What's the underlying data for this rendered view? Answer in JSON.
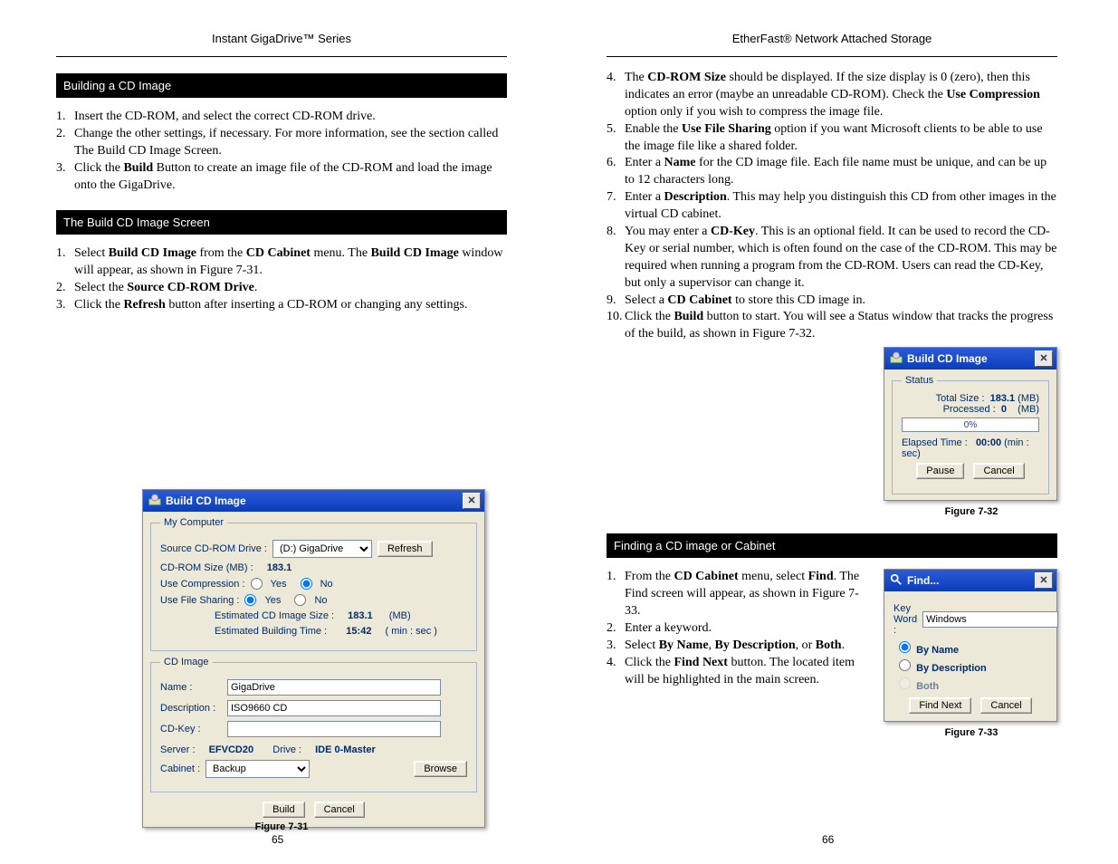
{
  "left": {
    "series_title": "Instant GigaDrive™ Series",
    "section_build_title": "Building a CD Image",
    "build_steps": [
      "Insert the CD-ROM, and select the correct CD-ROM drive.",
      "Change the other settings, if necessary. For more information, see the section called The Build CD Image Screen.",
      "Click the Build Button to create an image file of the CD-ROM and load the image onto the GigaDrive."
    ],
    "section_screen_title": "The Build CD Image Screen",
    "screen_steps": [
      "Select Build CD Image from the CD Cabinet menu. The Build CD Image window will appear, as shown in Figure 7-31.",
      "Select the Source CD-ROM Drive.",
      "Click the Refresh button after inserting a CD-ROM or changing any settings."
    ],
    "dlg": {
      "title": "Build CD Image",
      "grp_mycomputer": "My Computer",
      "src_label": "Source CD-ROM Drive :",
      "drive_options": [
        "(D:) GigaDrive"
      ],
      "refresh": "Refresh",
      "size_label": "CD-ROM Size (MB) :",
      "size_value": "183.1",
      "compress_label": "Use Compression :",
      "fileshare_label": "Use File Sharing :",
      "yes": "Yes",
      "no": "No",
      "est_size_label": "Estimated CD Image Size :",
      "est_size_value": "183.1",
      "est_size_unit": "(MB)",
      "est_time_label": "Estimated Building Time :",
      "est_time_value": "15:42",
      "est_time_unit": "( min : sec )",
      "grp_cdimage": "CD Image",
      "name_label": "Name :",
      "name_value": "GigaDrive",
      "desc_label": "Description :",
      "desc_value": "ISO9660 CD",
      "cdkey_label": "CD-Key :",
      "cdkey_value": "",
      "server_label": "Server :",
      "server_value": "EFVCD20",
      "drive_label": "Drive :",
      "drive_value": "IDE 0-Master",
      "cab_label": "Cabinet :",
      "cab_options": [
        "Backup"
      ],
      "browse": "Browse",
      "build": "Build",
      "cancel": "Cancel"
    },
    "fig_caption": "Figure 7-31",
    "page_number": "65"
  },
  "right": {
    "series_title": "EtherFast® Network Attached Storage",
    "paragraphs": [
      {
        "n": "4.",
        "text": "The CD-ROM Size should be displayed. If the size display is 0 (zero), then this indicates an error (maybe an unreadable CD-ROM). Check the Use Compression option only if you wish to compress the image file."
      },
      {
        "n": "5.",
        "text": "Enable the Use File Sharing option if you want Microsoft clients to be able to use the image file like a shared folder."
      },
      {
        "n": "6.",
        "text": "Enter a Name for the CD image file. Each file name must be unique, and can be up to 12 characters long."
      },
      {
        "n": "7.",
        "text": "Enter a Description. This may help you distinguish this CD from other images in the virtual CD cabinet."
      },
      {
        "n": "8.",
        "text": "You may enter a CD-Key. This is an optional field. It can be used to record the CD-Key or serial number, which is often found on the case of the CD-ROM. This may be required when running a program from the CD-ROM. Users can read the CD-Key, but only a supervisor can change it."
      },
      {
        "n": "9.",
        "text": "Select a CD Cabinet to store this CD image in."
      },
      {
        "n": "10.",
        "text": "Click the Build button to start. You will see a Status window that tracks the progress of the build, as shown in Figure 7-32."
      }
    ],
    "status_caption": "Figure 7-32",
    "find_section_title": "Finding a CD image or Cabinet",
    "find_caption": "Figure 7-33",
    "find_body": [
      {
        "n": "1.",
        "text": "From the CD Cabinet menu, select Find. The Find screen will appear, as shown in Figure 7-33."
      },
      {
        "n": "2.",
        "text": "Enter a keyword."
      },
      {
        "n": "3.",
        "text": "Select By Name, By Description, or Both."
      },
      {
        "n": "4.",
        "text": "Click the Find Next button. The located item will be highlighted in the main screen."
      }
    ],
    "dlg_status": {
      "title": "Build CD Image",
      "grp": "Status",
      "total_label": "Total Size :",
      "total_value": "183.1",
      "unit": "(MB)",
      "processed_label": "Processed :",
      "processed_value": "0",
      "progress_text": "0%",
      "elapsed_label": "Elapsed Time :",
      "elapsed_value": "00:00",
      "elapsed_unit": "(min : sec)",
      "pause": "Pause",
      "cancel": "Cancel"
    },
    "dlg_find": {
      "title": "Find...",
      "keyword_label": "Key Word :",
      "keyword_value": "Windows",
      "r_name": "By Name",
      "r_desc": "By Description",
      "r_both": "Both",
      "find_next": "Find Next",
      "cancel": "Cancel"
    },
    "page_number": "66"
  }
}
